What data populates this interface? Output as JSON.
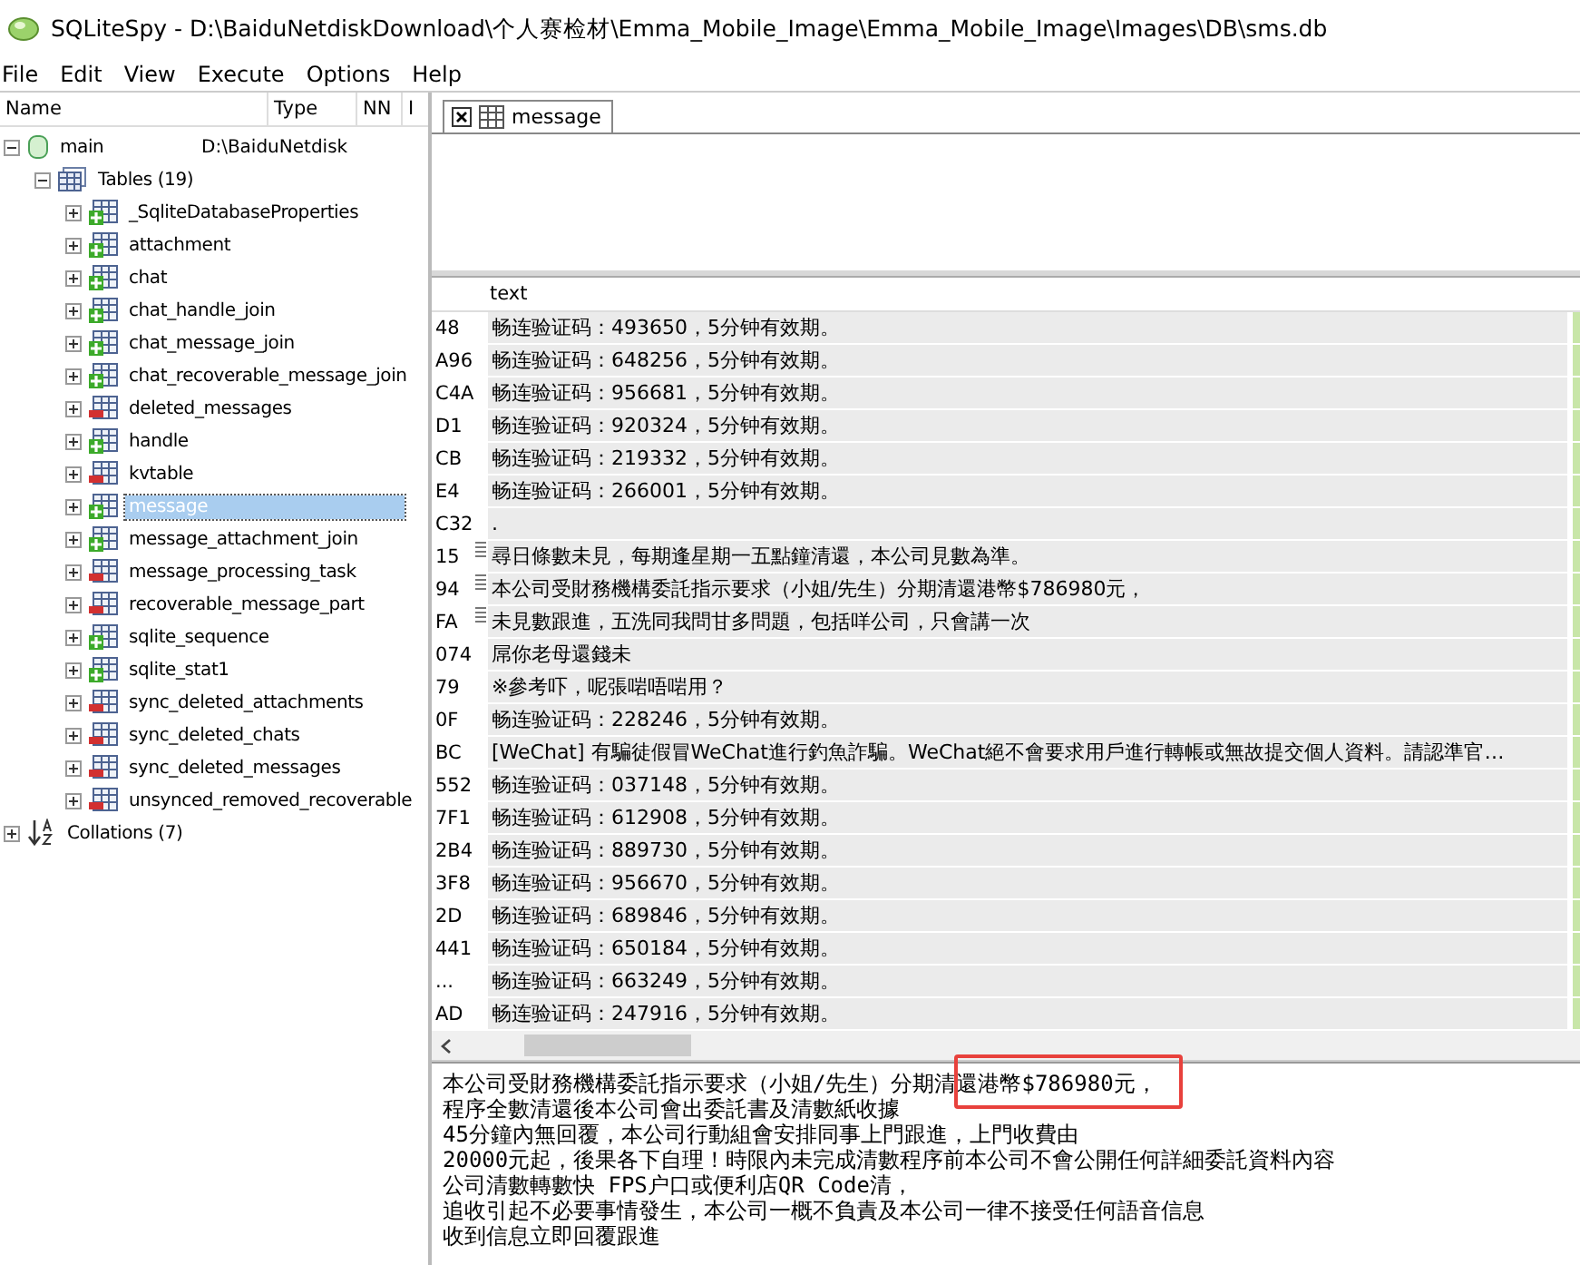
{
  "window": {
    "title": "SQLiteSpy - D:\\BaiduNetdiskDownload\\个人赛检材\\Emma_Mobile_Image\\Emma_Mobile_Image\\Images\\DB\\sms.db"
  },
  "menu": [
    "File",
    "Edit",
    "View",
    "Execute",
    "Options",
    "Help"
  ],
  "tree": {
    "columns": [
      "Name",
      "Type",
      "NN",
      "I"
    ],
    "root": {
      "label": "main",
      "type": "D:\\BaiduNetdisk",
      "expanded": true,
      "children": [
        {
          "label": "Tables (19)",
          "kind": "tables",
          "expanded": true,
          "children": [
            {
              "label": "_SqliteDatabaseProperties",
              "kind": "plus",
              "selected": false
            },
            {
              "label": "attachment",
              "kind": "plus",
              "selected": false
            },
            {
              "label": "chat",
              "kind": "plus",
              "selected": false
            },
            {
              "label": "chat_handle_join",
              "kind": "plus",
              "selected": false
            },
            {
              "label": "chat_message_join",
              "kind": "plus",
              "selected": false
            },
            {
              "label": "chat_recoverable_message_join",
              "kind": "plus",
              "selected": false
            },
            {
              "label": "deleted_messages",
              "kind": "minus",
              "selected": false
            },
            {
              "label": "handle",
              "kind": "plus",
              "selected": false
            },
            {
              "label": "kvtable",
              "kind": "minus",
              "selected": false
            },
            {
              "label": "message",
              "kind": "plus",
              "selected": true
            },
            {
              "label": "message_attachment_join",
              "kind": "plus",
              "selected": false
            },
            {
              "label": "message_processing_task",
              "kind": "minus",
              "selected": false
            },
            {
              "label": "recoverable_message_part",
              "kind": "minus",
              "selected": false
            },
            {
              "label": "sqlite_sequence",
              "kind": "plus",
              "selected": false
            },
            {
              "label": "sqlite_stat1",
              "kind": "plus",
              "selected": false
            },
            {
              "label": "sync_deleted_attachments",
              "kind": "minus",
              "selected": false
            },
            {
              "label": "sync_deleted_chats",
              "kind": "minus",
              "selected": false
            },
            {
              "label": "sync_deleted_messages",
              "kind": "minus",
              "selected": false
            },
            {
              "label": "unsynced_removed_recoverable",
              "kind": "minus",
              "selected": false
            }
          ]
        }
      ]
    },
    "collations": {
      "label": "Collations (7)",
      "expanded": false
    }
  },
  "tabs": [
    {
      "label": "message",
      "selected": true
    }
  ],
  "grid": {
    "columns": [
      "text"
    ],
    "rows": [
      {
        "id": "48",
        "text": "畅连验证码：493650，5分钟有效期。",
        "multiline": false
      },
      {
        "id": "A96",
        "text": "畅连验证码：648256，5分钟有效期。",
        "multiline": false
      },
      {
        "id": "C4A",
        "text": "畅连验证码：956681，5分钟有效期。",
        "multiline": false
      },
      {
        "id": "D1",
        "text": "畅连验证码：920324，5分钟有效期。",
        "multiline": false
      },
      {
        "id": "CB",
        "text": "畅连验证码：219332，5分钟有效期。",
        "multiline": false
      },
      {
        "id": "E4",
        "text": "畅连验证码：266001，5分钟有效期。",
        "multiline": false
      },
      {
        "id": "C32",
        "text": ".",
        "multiline": false
      },
      {
        "id": "15",
        "text": "尋日條數未見，每期逢星期一五點鐘清還，本公司見數為準。",
        "multiline": true
      },
      {
        "id": "94",
        "text": "本公司受財務機構委託指示要求（小姐/先生）分期清還港幣$786980元，",
        "multiline": true
      },
      {
        "id": "FA",
        "text": "未見數跟進，五洗同我問甘多問題，包括咩公司，只會講一次",
        "multiline": true
      },
      {
        "id": "074",
        "text": "屌你老母還錢未",
        "multiline": false
      },
      {
        "id": "79",
        "text": "※參考吓，呢張啱唔啱用？",
        "multiline": false
      },
      {
        "id": "0F",
        "text": "畅连验证码：228246，5分钟有效期。",
        "multiline": false
      },
      {
        "id": "BC",
        "text": "[WeChat] 有騙徒假冒WeChat進行釣魚詐騙。WeChat絕不會要求用戶進行轉帳或無故提交個人資料。請認準官…",
        "multiline": false
      },
      {
        "id": "552",
        "text": "畅连验证码：037148，5分钟有效期。",
        "multiline": false
      },
      {
        "id": "7F1",
        "text": "畅连验证码：612908，5分钟有效期。",
        "multiline": false
      },
      {
        "id": "2B4",
        "text": "畅连验证码：889730，5分钟有效期。",
        "multiline": false
      },
      {
        "id": "3F8",
        "text": "畅连验证码：956670，5分钟有效期。",
        "multiline": false
      },
      {
        "id": "2D",
        "text": "畅连验证码：689846，5分钟有效期。",
        "multiline": false
      },
      {
        "id": "441",
        "text": "畅连验证码：650184，5分钟有效期。",
        "multiline": false
      },
      {
        "id": "...",
        "text": "畅连验证码：663249，5分钟有效期。",
        "multiline": false
      },
      {
        "id": "AD",
        "text": "畅连验证码：247916，5分钟有效期。",
        "multiline": false
      }
    ]
  },
  "detail": {
    "lines": [
      "本公司受財務機構委託指示要求（小姐/先生）分期清還港幣$786980元，",
      "程序全數清還後本公司會出委託書及清數紙收據",
      "45分鐘內無回覆，本公司行動組會安排同事上門跟進，上門收費由",
      "20000元起，後果各下自理！時限內未完成清數程序前本公司不會公開任何詳細委託資料內容",
      "公司清數轉數快 FPS户口或便利店QR Code清，",
      "追收引起不必要事情發生，本公司一概不負責及本公司一律不接受任何語音信息",
      "收到信息立即回覆跟進"
    ],
    "annotation": {
      "kind": "rectangle"
    }
  }
}
